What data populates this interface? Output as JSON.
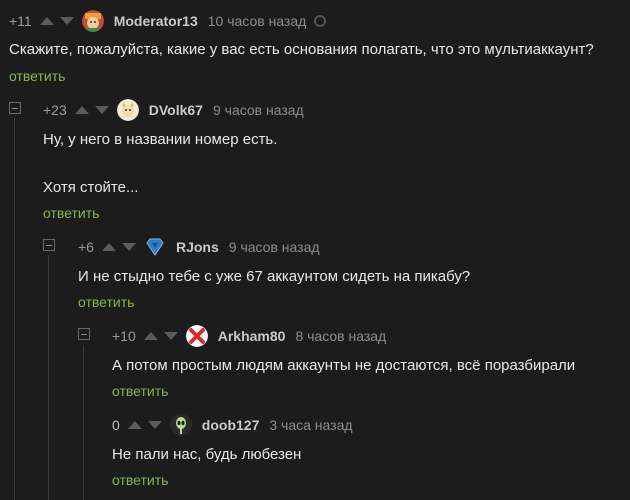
{
  "comments": [
    {
      "score": "+11",
      "user": "Moderator13",
      "time": "10 часов назад",
      "text_lines": [
        "Скажите, пожалуйста, какие у вас есть основания полагать, что это мультиаккаунт?"
      ],
      "reply_label": "ответить",
      "avatar_icon": "moderator-avatar-icon"
    },
    {
      "score": "+23",
      "user": "DVolk67",
      "time": "9 часов назад",
      "text_lines": [
        "Ну, у него в названии номер есть.",
        "Хотя стойте..."
      ],
      "reply_label": "ответить",
      "avatar_icon": "cat-avatar-icon"
    },
    {
      "score": "+6",
      "user": "RJons",
      "time": "9 часов назад",
      "text_lines": [
        "И не стыдно тебе с уже 67 аккаунтом сидеть на пикабу?"
      ],
      "reply_label": "ответить",
      "avatar_icon": "superman-logo-icon"
    },
    {
      "score": "+10",
      "user": "Arkham80",
      "time": "8 часов назад",
      "text_lines": [
        "А потом простым людям аккаунты не достаются, всё поразбирали"
      ],
      "reply_label": "ответить",
      "avatar_icon": "red-cross-icon"
    },
    {
      "score": "0",
      "user": "doob127",
      "time": "3 часа назад",
      "text_lines": [
        "Не пали нас, будь любезен"
      ],
      "reply_label": "ответить",
      "avatar_icon": "alien-avatar-icon"
    }
  ],
  "colors": {
    "background": "#1c1c1c",
    "reply_link": "#8ab44c",
    "username": "#c9c9c9",
    "muted": "#8c8c8c"
  }
}
